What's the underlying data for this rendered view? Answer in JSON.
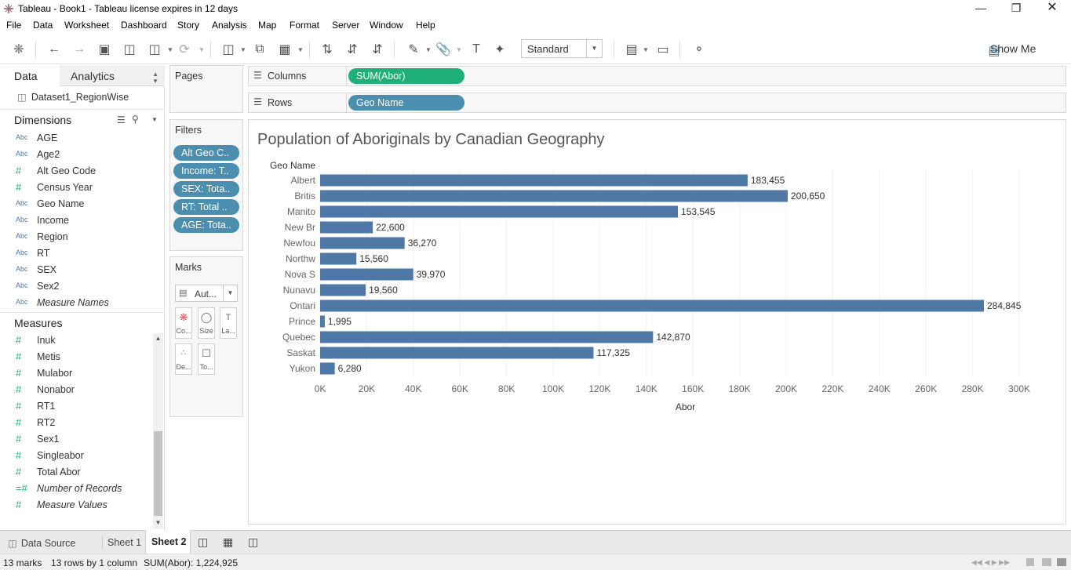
{
  "window": {
    "title": "Tableau - Book1 - Tableau license expires in 12 days"
  },
  "menu": [
    "File",
    "Data",
    "Worksheet",
    "Dashboard",
    "Story",
    "Analysis",
    "Map",
    "Format",
    "Server",
    "Window",
    "Help"
  ],
  "toolbar": {
    "fit_mode": "Standard",
    "show_me": "Show Me"
  },
  "left_pane": {
    "tab_data": "Data",
    "tab_analytics": "Analytics",
    "datasource": "Dataset1_RegionWise",
    "dimensions_header": "Dimensions",
    "dimensions": [
      {
        "type": "Abc",
        "name": "AGE"
      },
      {
        "type": "Abc",
        "name": "Age2"
      },
      {
        "type": "#",
        "name": "Alt Geo Code"
      },
      {
        "type": "#",
        "name": "Census Year"
      },
      {
        "type": "Abc",
        "name": "Geo Name"
      },
      {
        "type": "Abc",
        "name": "Income"
      },
      {
        "type": "Abc",
        "name": "Region"
      },
      {
        "type": "Abc",
        "name": "RT"
      },
      {
        "type": "Abc",
        "name": "SEX"
      },
      {
        "type": "Abc",
        "name": "Sex2"
      },
      {
        "type": "Abc",
        "name": "Measure Names"
      }
    ],
    "measures_header": "Measures",
    "measures": [
      {
        "type": "#",
        "name": "Inuk"
      },
      {
        "type": "#",
        "name": "Metis"
      },
      {
        "type": "#",
        "name": "Mulabor"
      },
      {
        "type": "#",
        "name": "Nonabor"
      },
      {
        "type": "#",
        "name": "RT1"
      },
      {
        "type": "#",
        "name": "RT2"
      },
      {
        "type": "#",
        "name": "Sex1"
      },
      {
        "type": "#",
        "name": "Singleabor"
      },
      {
        "type": "#",
        "name": "Total Abor"
      },
      {
        "type": "=#",
        "name": "Number of Records"
      },
      {
        "type": "#",
        "name": "Measure Values"
      }
    ]
  },
  "pages": {
    "title": "Pages"
  },
  "filters": {
    "title": "Filters",
    "pills": [
      "Alt Geo C..",
      "Income: T..",
      "SEX: Tota..",
      "RT: Total ..",
      "AGE: Tota.."
    ]
  },
  "marks": {
    "title": "Marks",
    "type": "Aut...",
    "buttons": [
      "Co...",
      "Size",
      "La...",
      "De...",
      "To..."
    ]
  },
  "shelves": {
    "columns_label": "Columns",
    "columns_pill": "SUM(Abor)",
    "rows_label": "Rows",
    "rows_pill": "Geo Name"
  },
  "chart_data": {
    "type": "bar",
    "orientation": "horizontal",
    "title": "Population of Aboriginals by Canadian Geography",
    "row_header": "Geo Name",
    "xlabel": "Abor",
    "xlim": [
      0,
      300000
    ],
    "xticks": [
      "0K",
      "20K",
      "40K",
      "60K",
      "80K",
      "100K",
      "120K",
      "140K",
      "160K",
      "180K",
      "200K",
      "220K",
      "240K",
      "260K",
      "280K",
      "300K"
    ],
    "categories": [
      "Albert",
      "Britis",
      "Manito",
      "New Br",
      "Newfou",
      "Northw",
      "Nova S",
      "Nunavu",
      "Ontari",
      "Prince",
      "Quebec",
      "Saskat",
      "Yukon"
    ],
    "values": [
      183455,
      200650,
      153545,
      22600,
      36270,
      15560,
      39970,
      19560,
      284845,
      1995,
      142870,
      117325,
      6280
    ],
    "labels": [
      "183,455",
      "200,650",
      "153,545",
      "22,600",
      "36,270",
      "15,560",
      "39,970",
      "19,560",
      "284,845",
      "1,995",
      "142,870",
      "117,325",
      "6,280"
    ],
    "bar_color": "#4e79a7",
    "grid": true
  },
  "bottom_tabs": {
    "datasource": "Data Source",
    "sheet1": "Sheet 1",
    "sheet2": "Sheet 2"
  },
  "status": {
    "marks": "13 marks",
    "rows": "13 rows by 1 column",
    "sum": "SUM(Abor): 1,224,925"
  }
}
